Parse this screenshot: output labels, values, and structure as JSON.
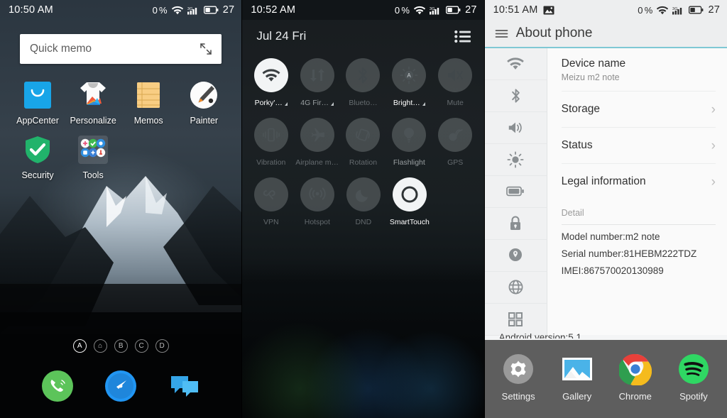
{
  "panels": {
    "home": {
      "status": {
        "time": "10:50 AM",
        "data_rate": "0",
        "data_unit": "%",
        "battery": "27",
        "wifi_icon": "wifi-icon",
        "signal_icon": "signal-3g-icon",
        "battery_icon": "battery-icon"
      },
      "quick_memo": {
        "placeholder": "Quick memo",
        "expand_icon": "expand-icon"
      },
      "apps": [
        {
          "label": "AppCenter",
          "icon": "appcenter-icon"
        },
        {
          "label": "Personalize",
          "icon": "personalize-icon"
        },
        {
          "label": "Memos",
          "icon": "memos-icon"
        },
        {
          "label": "Painter",
          "icon": "painter-icon"
        },
        {
          "label": "Security",
          "icon": "security-shield-icon"
        },
        {
          "label": "Tools",
          "icon": "tools-folder-icon"
        }
      ],
      "page_indicators": [
        {
          "label": "A",
          "active": true
        },
        {
          "label": "⌂",
          "active": false
        },
        {
          "label": "B",
          "active": false
        },
        {
          "label": "C",
          "active": false
        },
        {
          "label": "D",
          "active": false
        }
      ],
      "dock": [
        {
          "name": "phone-dock-icon"
        },
        {
          "name": "browser-dock-icon"
        },
        {
          "name": "messaging-dock-icon"
        }
      ]
    },
    "quick_settings": {
      "status": {
        "time": "10:52 AM",
        "data_rate": "0",
        "data_unit": "%",
        "battery": "27"
      },
      "date": "Jul 24  Fri",
      "list_icon": "list-icon",
      "tiles": [
        [
          {
            "label": "Porky'…",
            "icon": "wifi-icon",
            "on": true,
            "dim": false,
            "arrow": true
          },
          {
            "label": "4G Fir…",
            "icon": "mobile-data-icon",
            "on": false,
            "dim": false,
            "arrow": true
          },
          {
            "label": "Blueto…",
            "icon": "bluetooth-icon",
            "on": false,
            "dim": true,
            "arrow": false
          },
          {
            "label": "Bright…",
            "icon": "brightness-auto-icon",
            "on": false,
            "dim": false,
            "arrow": true
          },
          {
            "label": "Mute",
            "icon": "mute-icon",
            "on": false,
            "dim": true,
            "arrow": false
          }
        ],
        [
          {
            "label": "Vibration",
            "icon": "vibration-icon",
            "on": false,
            "dim": true,
            "arrow": false
          },
          {
            "label": "Airplane m…",
            "icon": "airplane-icon",
            "on": false,
            "dim": true,
            "arrow": false
          },
          {
            "label": "Rotation",
            "icon": "rotation-icon",
            "on": false,
            "dim": true,
            "arrow": false
          },
          {
            "label": "Flashlight",
            "icon": "flashlight-icon",
            "on": false,
            "dim": false,
            "arrow": false
          },
          {
            "label": "GPS",
            "icon": "gps-icon",
            "on": false,
            "dim": true,
            "arrow": false
          }
        ],
        [
          {
            "label": "VPN",
            "icon": "vpn-icon",
            "on": false,
            "dim": true,
            "arrow": false
          },
          {
            "label": "Hotspot",
            "icon": "hotspot-icon",
            "on": false,
            "dim": true,
            "arrow": false
          },
          {
            "label": "DND",
            "icon": "dnd-moon-icon",
            "on": false,
            "dim": true,
            "arrow": false
          },
          {
            "label": "SmartTouch",
            "icon": "smarttouch-icon",
            "on": true,
            "dim": false,
            "arrow": false
          }
        ]
      ]
    },
    "settings": {
      "status": {
        "time": "10:51 AM",
        "data_rate": "0",
        "data_unit": "%",
        "battery": "27",
        "screenshot_icon": "image-icon"
      },
      "menu_icon": "hamburger-menu-icon",
      "title": "About phone",
      "accent_color": "#7fc8d4",
      "sidebar": [
        {
          "icon": "wifi-icon"
        },
        {
          "icon": "bluetooth-icon"
        },
        {
          "icon": "volume-icon"
        },
        {
          "icon": "brightness-icon"
        },
        {
          "icon": "battery-icon"
        },
        {
          "icon": "lock-icon"
        },
        {
          "icon": "location-pin-icon"
        },
        {
          "icon": "globe-icon"
        },
        {
          "icon": "apps-grid-icon"
        }
      ],
      "rows": [
        {
          "title": "Device name",
          "subtitle": "Meizu m2 note",
          "chevron": false
        },
        {
          "title": "Storage",
          "subtitle": "",
          "chevron": true
        },
        {
          "title": "Status",
          "subtitle": "",
          "chevron": true
        },
        {
          "title": "Legal information",
          "subtitle": "",
          "chevron": true
        }
      ],
      "detail_header": "Detail",
      "detail_lines": [
        "Model number:m2 note",
        "Serial number:81HEBM222TDZ",
        "IMEI:867570020130989"
      ],
      "detail_cut_line": "Android version:5.1",
      "dock": [
        {
          "label": "Settings",
          "icon": "gear-icon"
        },
        {
          "label": "Gallery",
          "icon": "gallery-icon"
        },
        {
          "label": "Chrome",
          "icon": "chrome-icon"
        },
        {
          "label": "Spotify",
          "icon": "spotify-icon"
        }
      ]
    }
  }
}
